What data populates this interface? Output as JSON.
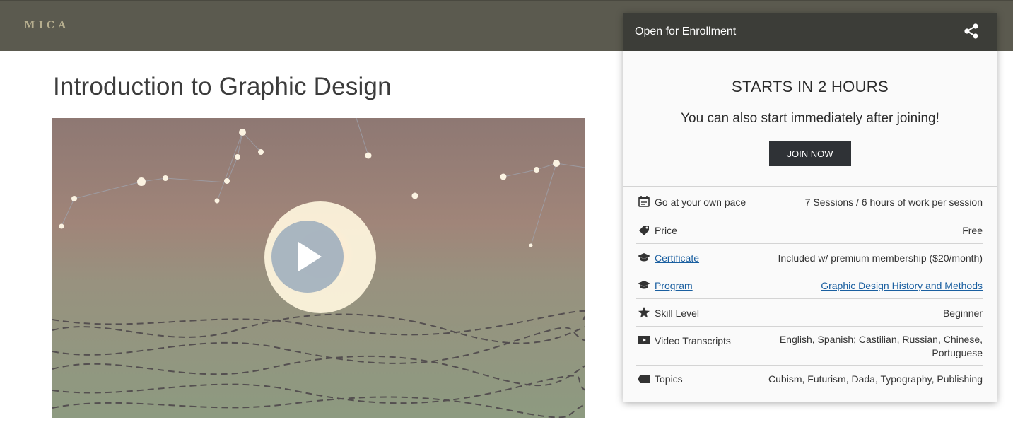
{
  "header": {
    "logo": "MICA"
  },
  "course": {
    "title": "Introduction to Graphic Design"
  },
  "video": {
    "play_icon": "play-icon"
  },
  "card": {
    "header_title": "Open for Enrollment",
    "share_icon": "share-icon",
    "starts": "STARTS IN 2 HOURS",
    "subtitle": "You can also start immediately after joining!",
    "join_label": "JOIN NOW",
    "rows": [
      {
        "icon": "calendar-icon",
        "label": "Go at your own pace",
        "value": "7 Sessions / 6 hours of work per session",
        "label_link": false,
        "value_link": false
      },
      {
        "icon": "price-tag-icon",
        "label": "Price",
        "value": "Free",
        "label_link": false,
        "value_link": false
      },
      {
        "icon": "graduation-cap-icon",
        "label": "Certificate",
        "value": "Included w/ premium membership ($20/month)",
        "label_link": true,
        "value_link": false
      },
      {
        "icon": "graduation-cap-icon",
        "label": "Program",
        "value": "Graphic Design History and Methods",
        "label_link": true,
        "value_link": true
      },
      {
        "icon": "star-icon",
        "label": "Skill Level",
        "value": "Beginner",
        "label_link": false,
        "value_link": false
      },
      {
        "icon": "video-play-icon",
        "label": "Video Transcripts",
        "value_line1": "English, Spanish; Castilian, Russian, Chinese,",
        "value_line2": "Portuguese",
        "label_link": false,
        "value_link": false
      },
      {
        "icon": "tag-icon",
        "label": "Topics",
        "value": "Cubism, Futurism, Dada, Typography, Publishing",
        "label_link": false,
        "value_link": false
      }
    ]
  },
  "colors": {
    "topbar": "#5b5a4f",
    "card_header": "#3c3d38",
    "button": "#2f3236",
    "link": "#1a5fa0"
  }
}
